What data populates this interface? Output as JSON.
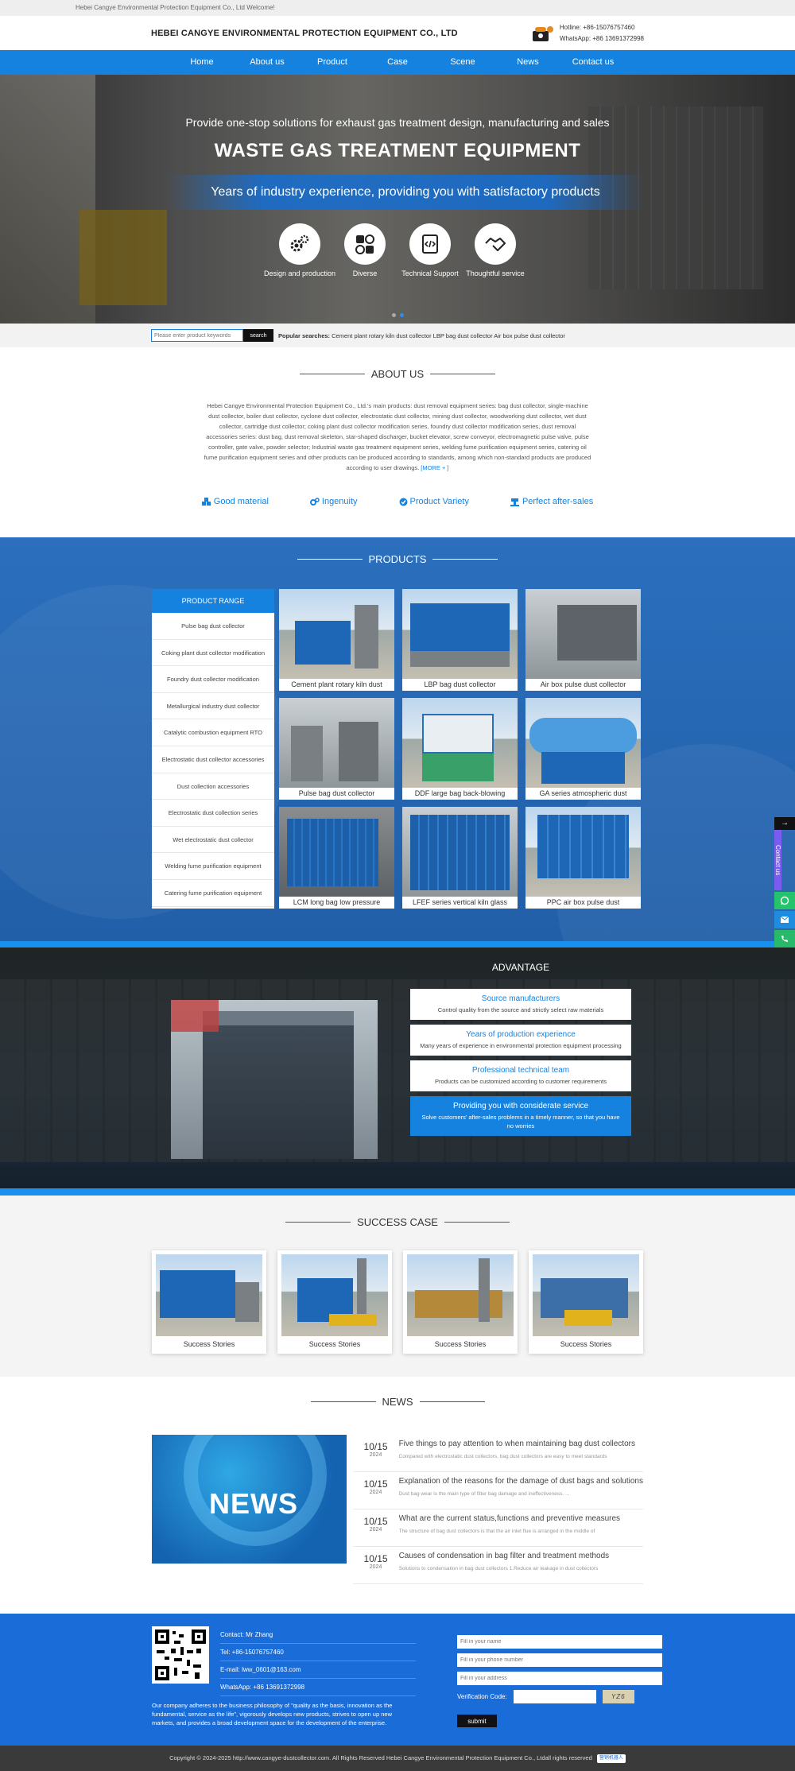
{
  "topbar": {
    "welcome": "Hebei Cangye Environmental Protection Equipment Co., Ltd Welcome!"
  },
  "header": {
    "company": "HEBEI CANGYE ENVIRONMENTAL PROTECTION EQUIPMENT CO., LTD",
    "hotline": "Hotline:  +86-15076757460",
    "whatsapp": "WhatsApp:  +86 13691372998"
  },
  "nav": [
    "Home",
    "About us",
    "Product",
    "Case",
    "Scene",
    "News",
    "Contact us"
  ],
  "hero": {
    "subtitle": "Provide one-stop solutions for exhaust gas treatment design, manufacturing and sales",
    "title": "WASTE GAS TREATMENT EQUIPMENT",
    "band": "Years of industry experience, providing you with satisfactory products",
    "icons": [
      {
        "label": "Design and production",
        "icon": "gears-icon"
      },
      {
        "label": "Diverse",
        "icon": "shapes-icon"
      },
      {
        "label": "Technical Support",
        "icon": "code-document-icon"
      },
      {
        "label": "Thoughtful service",
        "icon": "handshake-icon"
      }
    ]
  },
  "search": {
    "placeholder": "Please enter product keywords",
    "button": "search",
    "popular_label": "Popular searches:",
    "popular_terms": "Cement plant rotary kiln dust collector LBP bag dust collector Air box pulse dust collector"
  },
  "about": {
    "title": "ABOUT US",
    "text": "Hebei Cangye Environmental Protection Equipment Co., Ltd.'s main products: dust removal equipment series: bag dust collector, single-machine dust collector, boiler dust collector, cyclone dust collector, electrostatic dust collector, mining dust collector, woodworking dust collector, wet dust collector, cartridge dust collector; coking plant dust collector modification series, foundry dust collector modification series, dust removal accessories series: dust bag, dust removal skeleton, star-shaped discharger, bucket elevator, screw conveyor, electromagnetic pulse valve, pulse controller, gate valve, powder selector; Industrial waste gas treatment equipment series, welding fume purification equipment series, catering oil fume purification equipment series and other products can be produced according to standards, among which non-standard products are produced according to user drawings.",
    "more": "[MORE + ]",
    "features": [
      "Good material",
      "Ingenuity",
      "Product Variety",
      "Perfect after-sales"
    ]
  },
  "products": {
    "title": "PRODUCTS",
    "range_title": "PRODUCT RANGE",
    "range": [
      "Pulse bag dust collector",
      "Coking plant dust collector modification",
      "Foundry dust collector modification",
      "Metallurgical industry dust collector",
      "Catalytic combustion equipment RTO",
      "Electrostatic dust collector accessories",
      "Dust collection accessories",
      "Electrostatic dust collection series",
      "Wet electrostatic dust collector",
      "Welding fume purification equipment",
      "Catering fume purification equipment"
    ],
    "items": [
      "Cement plant rotary kiln dust",
      "LBP bag dust collector",
      "Air box pulse dust collector",
      "Pulse bag dust collector",
      "DDF large bag back-blowing",
      "GA series atmospheric dust",
      "LCM long bag low pressure",
      "LFEF series vertical kiln glass",
      "PPC air box pulse dust"
    ]
  },
  "advantage": {
    "title": "ADVANTAGE",
    "items": [
      {
        "title": "Source manufacturers",
        "desc": "Control quality from the source and strictly select raw materials"
      },
      {
        "title": "Years of production experience",
        "desc": "Many years of experience in environmental protection equipment processing"
      },
      {
        "title": "Professional technical team",
        "desc": "Products can be customized according to customer requirements"
      },
      {
        "title": "Providing you with considerate service",
        "desc": "Solve customers' after-sales problems in a timely manner, so that you have no worries"
      }
    ]
  },
  "cases": {
    "title": "SUCCESS CASE",
    "items": [
      "Success Stories",
      "Success Stories",
      "Success Stories",
      "Success Stories"
    ]
  },
  "news": {
    "title": "NEWS",
    "image_word": "NEWS",
    "items": [
      {
        "md": "10/15",
        "yr": "2024",
        "title": "Five things to pay attention to when maintaining bag dust collectors",
        "summary": "Compared with electrostatic dust collectors, bag dust collectors are easy to meet standards"
      },
      {
        "md": "10/15",
        "yr": "2024",
        "title": "Explanation of the reasons for the damage of dust bags and solutions",
        "summary": "Dust bag wear is the main type of filter bag damage and ineffectiveness. ..."
      },
      {
        "md": "10/15",
        "yr": "2024",
        "title": "What are the current status,functions and preventive measures",
        "summary": "The structure of bag dust collectors is that the air inlet flue is arranged in the middle of"
      },
      {
        "md": "10/15",
        "yr": "2024",
        "title": "Causes of condensation in bag filter and treatment methods",
        "summary": "Solutions to condensation in bag dust collectors 1.Reduce air leakage in dust collectors"
      }
    ]
  },
  "footer": {
    "contact": "Contact:  Mr Zhang",
    "tel": "Tel:  +86-15076757460",
    "email": "E-mail: lww_0601@163.com",
    "whatsapp": "WhatsApp:  +86 13691372998",
    "desc": "Our company adheres to the business philosophy of \"quality as the basis, innovation as the fundamental, service as the life\", vigorously develops new products, strives to open up new markets, and provides a broad development space for the development of the enterprise.",
    "name_ph": "Fill in your name",
    "phone_ph": "Fill in your phone number",
    "address_ph": "Fill in your address",
    "verify_label": "Verification Code:",
    "code": "YZ6",
    "submit": "submit",
    "copyright": "Copyright © 2024-2025 http://www.cangye-dustcollector.com. All Rights Reserved Hebei Cangye Environmental Protection Equipment Co., Ltdall rights reserved",
    "badge": "营销机器人"
  },
  "side": {
    "contact": "Contact us"
  },
  "colors": {
    "primary": "#1582e0",
    "footer": "#1a6cd8",
    "products_bg": "#2b6fbd"
  }
}
